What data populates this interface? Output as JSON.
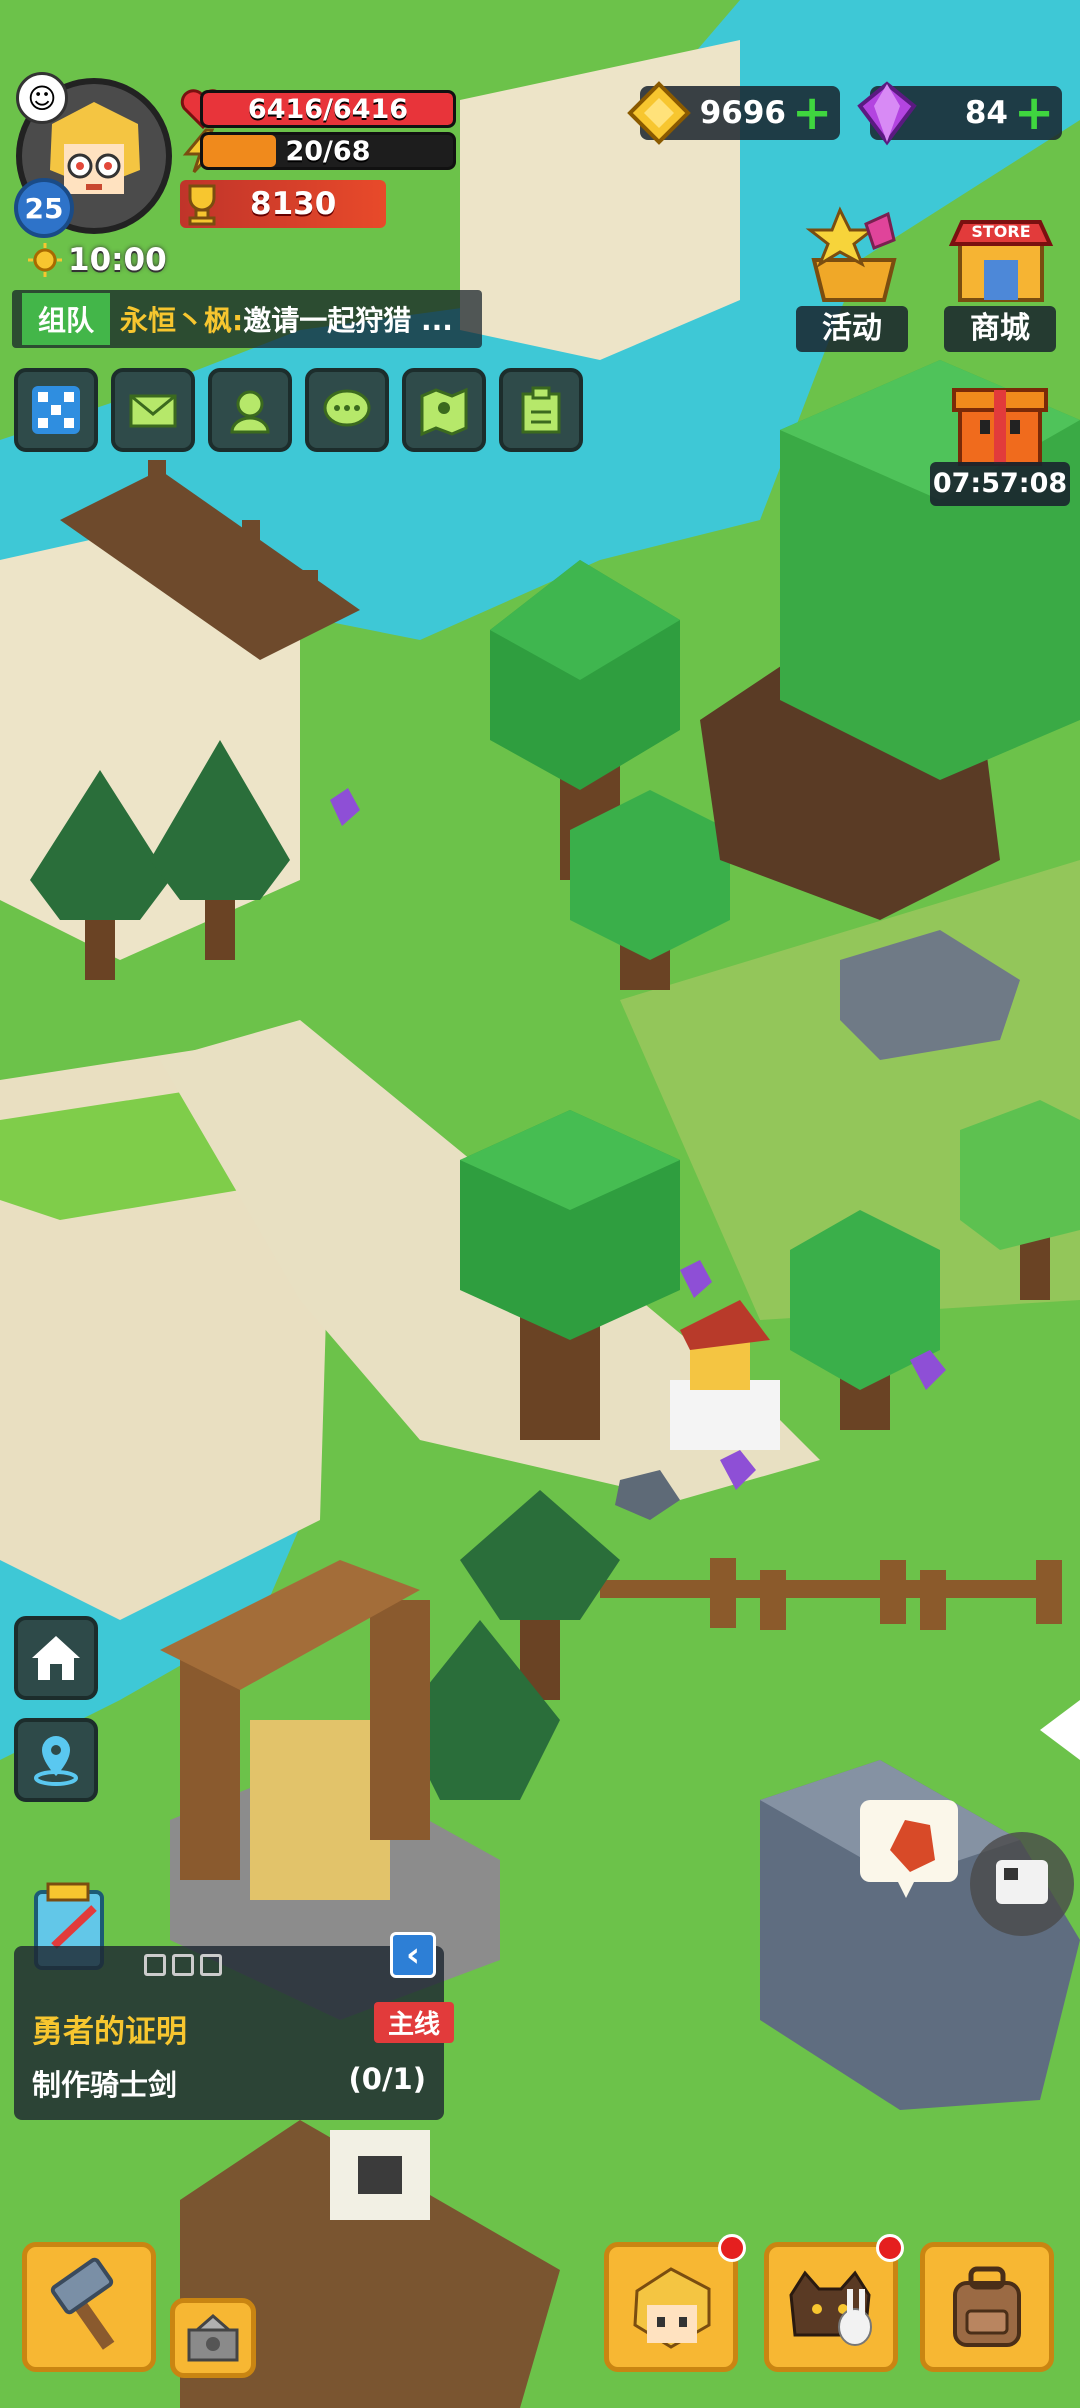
{
  "player": {
    "level": "25",
    "hp": "6416/6416",
    "hp_fraction": 1.0,
    "energy": "20/68",
    "energy_fraction": 0.29,
    "power": "8130",
    "time": "10:00"
  },
  "currency": {
    "gold": "9696",
    "gems": "84"
  },
  "team": {
    "tag": "组队",
    "name": "永恒丶枫:",
    "message": "邀请一起狩猎 ..."
  },
  "shop": {
    "event_label": "活动",
    "store_label": "商城",
    "store_sign": "STORE",
    "countdown": "07:57:08"
  },
  "quest": {
    "title": "勇者的证明",
    "tag": "主线",
    "objective": "制作骑士剑",
    "progress": "(0/1)"
  },
  "icons": {
    "top_row": [
      "map-grid-icon",
      "mail-icon",
      "friends-icon",
      "chat-icon",
      "world-map-icon",
      "notice-icon"
    ],
    "side": [
      "home-icon",
      "location-icon"
    ],
    "bottom": [
      "hammer-icon",
      "workbench-icon",
      "hero-icon",
      "pets-icon",
      "backpack-icon"
    ]
  },
  "colors": {
    "hp": "#e8343a",
    "energy": "#f08a1c",
    "gold": "#f7c62f",
    "gem": "#b344e0",
    "grass": "#6cc24a",
    "water": "#3ec8d6"
  }
}
